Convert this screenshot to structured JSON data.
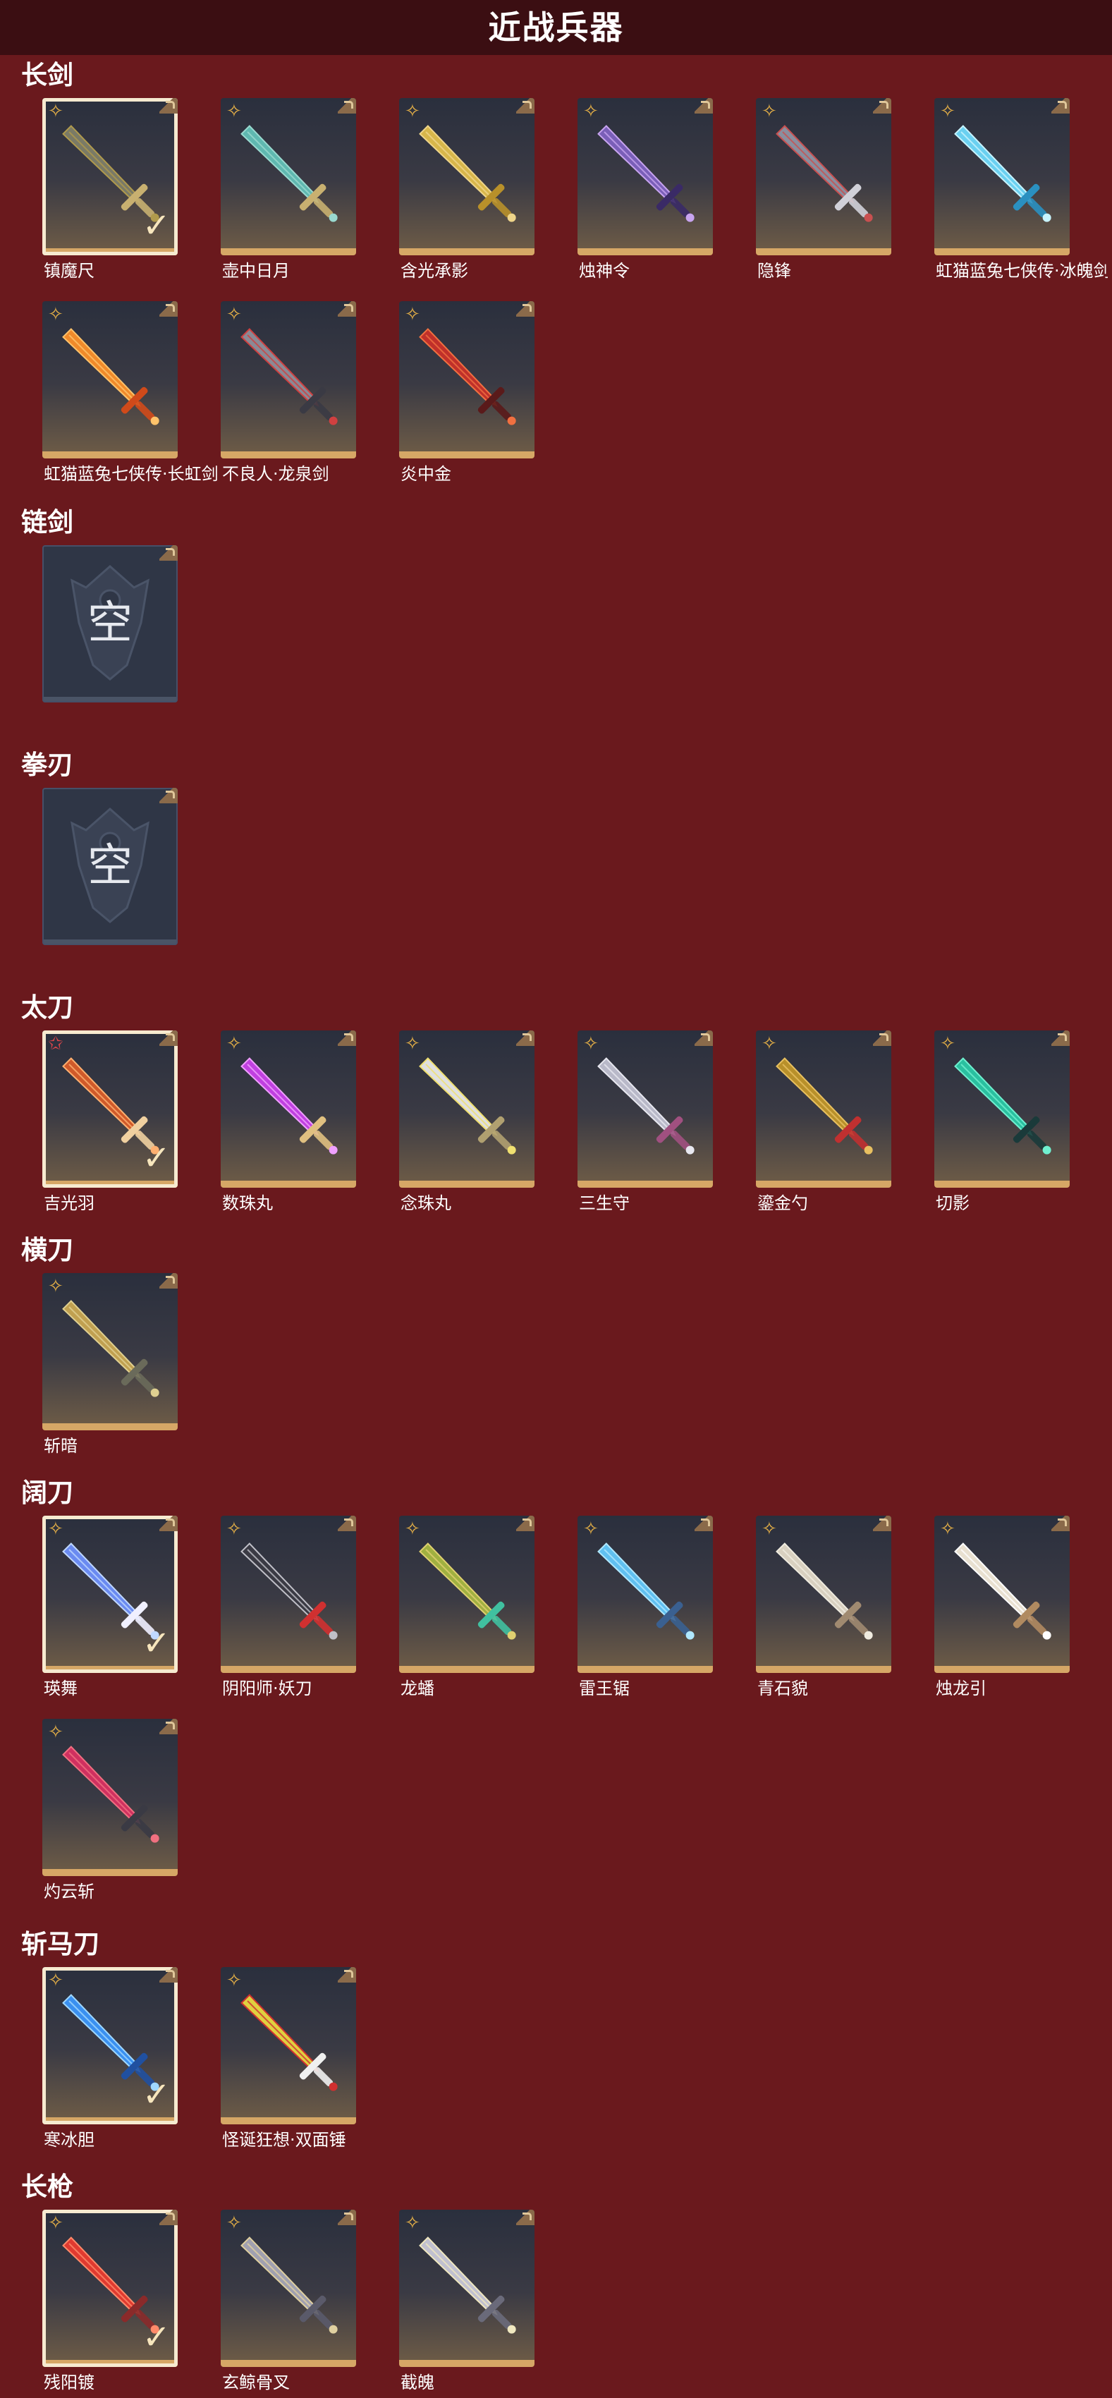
{
  "header": {
    "title": "近战兵器"
  },
  "icons": {
    "rarity": "star-badge-icon",
    "equipped": "checkmark-icon",
    "corner": "expand-corner-icon",
    "empty": "empty-slot-emblem-icon"
  },
  "colors": {
    "background": "#6a191d",
    "header_bg": "#3b0e12",
    "card_trim": "#d6a766",
    "rarity_gold": "#e8b247",
    "rarity_red": "#e0474b"
  },
  "sections": [
    {
      "title": "长剑",
      "items": [
        {
          "label": "镇魔尺",
          "rarity": "gold",
          "equipped": true
        },
        {
          "label": "壶中日月",
          "rarity": "gold",
          "equipped": false
        },
        {
          "label": "含光承影",
          "rarity": "gold",
          "equipped": false
        },
        {
          "label": "烛神令",
          "rarity": "gold",
          "equipped": false
        },
        {
          "label": "隐锋",
          "rarity": "gold",
          "equipped": false
        },
        {
          "label": "虹猫蓝兔七侠传·冰魄剑",
          "rarity": "gold",
          "equipped": false
        },
        {
          "label": "虹猫蓝兔七侠传·长虹剑",
          "rarity": "gold",
          "equipped": false
        },
        {
          "label": "不良人·龙泉剑",
          "rarity": "gold",
          "equipped": false
        },
        {
          "label": "炎中金",
          "rarity": "gold",
          "equipped": false
        }
      ]
    },
    {
      "title": "链剑",
      "items": [
        {
          "label": "",
          "empty": true,
          "empty_text": "空"
        }
      ]
    },
    {
      "title": "拳刃",
      "items": [
        {
          "label": "",
          "empty": true,
          "empty_text": "空"
        }
      ]
    },
    {
      "title": "太刀",
      "items": [
        {
          "label": "吉光羽",
          "rarity": "red",
          "equipped": true
        },
        {
          "label": "数珠丸",
          "rarity": "gold",
          "equipped": false
        },
        {
          "label": "念珠丸",
          "rarity": "gold",
          "equipped": false
        },
        {
          "label": "三生守",
          "rarity": "gold",
          "equipped": false
        },
        {
          "label": "鎏金勺",
          "rarity": "gold",
          "equipped": false
        },
        {
          "label": "切影",
          "rarity": "gold",
          "equipped": false
        }
      ]
    },
    {
      "title": "横刀",
      "items": [
        {
          "label": "斩暗",
          "rarity": "gold",
          "equipped": false
        }
      ]
    },
    {
      "title": "阔刀",
      "items": [
        {
          "label": "瑛舞",
          "rarity": "gold",
          "equipped": true
        },
        {
          "label": "阴阳师·妖刀",
          "rarity": "gold",
          "equipped": false
        },
        {
          "label": "龙蟠",
          "rarity": "gold",
          "equipped": false
        },
        {
          "label": "雷王锯",
          "rarity": "gold",
          "equipped": false
        },
        {
          "label": "青石貌",
          "rarity": "gold",
          "equipped": false
        },
        {
          "label": "烛龙引",
          "rarity": "gold",
          "equipped": false
        },
        {
          "label": "灼云斩",
          "rarity": "gold",
          "equipped": false
        }
      ]
    },
    {
      "title": "斩马刀",
      "items": [
        {
          "label": "寒冰胆",
          "rarity": "gold",
          "equipped": true
        },
        {
          "label": "怪诞狂想·双面锤",
          "rarity": "gold",
          "equipped": false
        }
      ]
    },
    {
      "title": "长枪",
      "items": [
        {
          "label": "残阳镀",
          "rarity": "gold",
          "equipped": true
        },
        {
          "label": "玄鲸骨叉",
          "rarity": "gold",
          "equipped": false
        },
        {
          "label": "截魄",
          "rarity": "gold",
          "equipped": false
        }
      ]
    }
  ]
}
